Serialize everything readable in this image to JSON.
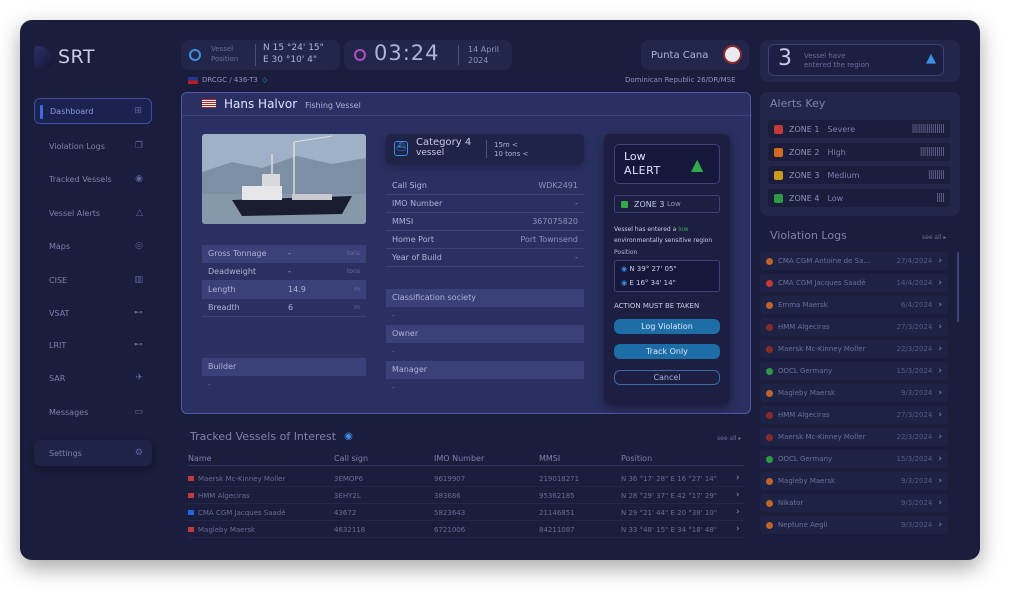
{
  "brand": {
    "name": "SRT"
  },
  "sidebar": {
    "items": [
      {
        "label": "Dashboard",
        "icon": "grid-icon"
      },
      {
        "label": "Violation Logs",
        "icon": "copy-icon"
      },
      {
        "label": "Tracked Vessels",
        "icon": "radar-icon"
      },
      {
        "label": "Vessel Alerts",
        "icon": "warning-icon"
      },
      {
        "label": "Maps",
        "icon": "globe-icon"
      },
      {
        "label": "CISE",
        "icon": "building-icon"
      },
      {
        "label": "VSAT",
        "icon": "satellite-icon"
      },
      {
        "label": "LRIT",
        "icon": "satellite-icon"
      },
      {
        "label": "SAR",
        "icon": "plane-icon"
      },
      {
        "label": "Messages",
        "icon": "chat-icon"
      }
    ],
    "settings": "Settings"
  },
  "topbar": {
    "position_label_1": "Vessel",
    "position_label_2": "Position",
    "lat": "N 15 °24' 15\"",
    "lon": "E 30 °10' 4\"",
    "time": "03:24",
    "date_1": "14 April",
    "date_2": "2024",
    "location": "Punta Cana",
    "vessel_code": "DRCGC / 436-T3",
    "region": "Dominican Republic 26/DR/MSE",
    "vessels_count": "3",
    "vessels_text_1": "Vessel have",
    "vessels_text_2": "entered the region"
  },
  "modal": {
    "vessel_name": "Hans Halvor",
    "vessel_type": "Fishing Vessel",
    "category": "Category 4",
    "category_sub": "vessel",
    "dim1": "15m <",
    "dim2": "10 tons <",
    "info_rows": [
      {
        "label": "Call Sign",
        "value": "WDK2491"
      },
      {
        "label": "IMO Number",
        "value": "-"
      },
      {
        "label": "MMSI",
        "value": "367075820"
      },
      {
        "label": "Home Port",
        "value": "Port Townsend"
      },
      {
        "label": "Year of Build",
        "value": "-"
      }
    ],
    "specs": [
      {
        "label": "Gross Tonnage",
        "value": "-",
        "unit": "tons"
      },
      {
        "label": "Deadweight",
        "value": "-",
        "unit": "tons"
      },
      {
        "label": "Length",
        "value": "14.9",
        "unit": "m"
      },
      {
        "label": "Breadth",
        "value": "6",
        "unit": "m"
      }
    ],
    "builder_label": "Builder",
    "builder_value": "-",
    "classification_label": "Classification society",
    "classification_value": "-",
    "owner_label": "Owner",
    "owner_value": "-",
    "manager_label": "Manager",
    "manager_value": "-"
  },
  "alert_panel": {
    "title_1": "Low",
    "title_2": "ALERT",
    "zone": "ZONE 3",
    "zone_level": "Low",
    "message_1": "Vessel has entered a",
    "message_low": "low",
    "message_2": "environmentally sensitive region",
    "position_label": "Position",
    "lat": "N 39° 27' 05\"",
    "lon": "E 16° 34' 14\"",
    "action": "ACTION MUST BE TAKEN",
    "btn_log": "Log Violation",
    "btn_track": "Track Only",
    "btn_cancel": "Cancel"
  },
  "alerts_key": {
    "title": "Alerts Key",
    "zones": [
      {
        "zone": "ZONE 1",
        "level": "Severe",
        "color": "#c23a3a",
        "bars": "||||||||||||||||"
      },
      {
        "zone": "ZONE 2",
        "level": "High",
        "color": "#d36a22",
        "bars": "||||||||||||"
      },
      {
        "zone": "ZONE 3",
        "level": "Medium",
        "color": "#c99a1c",
        "bars": "||||||||"
      },
      {
        "zone": "ZONE 4",
        "level": "Low",
        "color": "#2f9a43",
        "bars": "||||"
      }
    ]
  },
  "violation_logs": {
    "title": "Violation Logs",
    "see_all": "see all",
    "items": [
      {
        "name": "CMA CGM Antoine de Sa...",
        "date": "27/4/2024",
        "color": "#c0652a"
      },
      {
        "name": "CMA CGM Jacques Saadé",
        "date": "14/4/2024",
        "color": "#c23a3a"
      },
      {
        "name": "Emma Maersk",
        "date": "6/4/2024",
        "color": "#c0652a"
      },
      {
        "name": "HMM Algeciras",
        "date": "27/3/2024",
        "color": "#8a2a2a"
      },
      {
        "name": "Maersk Mc-Kinney Moller",
        "date": "22/3/2024",
        "color": "#8a2a2a"
      },
      {
        "name": "OOCL Germany",
        "date": "15/3/2024",
        "color": "#2f9a43"
      },
      {
        "name": "Magleby Maersk",
        "date": "9/3/2024",
        "color": "#c0652a"
      },
      {
        "name": "HMM Algeciras",
        "date": "27/3/2024",
        "color": "#8a2a2a"
      },
      {
        "name": "Maersk Mc-Kinney Moller",
        "date": "22/3/2024",
        "color": "#8a2a2a"
      },
      {
        "name": "OOCL Germany",
        "date": "15/3/2024",
        "color": "#2f9a43"
      },
      {
        "name": "Magleby Maersk",
        "date": "9/3/2024",
        "color": "#c0652a"
      },
      {
        "name": "Nikator",
        "date": "9/3/2024",
        "color": "#c0652a"
      },
      {
        "name": "Neptune Aegli",
        "date": "9/3/2024",
        "color": "#c0652a"
      }
    ]
  },
  "tracked": {
    "title": "Tracked Vessels of Interest",
    "see_all": "see all",
    "columns": [
      "Name",
      "Call sign",
      "IMO Number",
      "MMSI",
      "Position"
    ],
    "rows": [
      {
        "name": "Maersk Mc-Kinney Moller",
        "call": "3EMOP6",
        "imo": "9619907",
        "mmsi": "219018271",
        "pos": "N 36 °17' 28\" E 16 °27' 14\""
      },
      {
        "name": "HMM Algeciras",
        "call": "3EHY2L",
        "imo": "383686",
        "mmsi": "95362185",
        "pos": "N 28 °29' 37\" E 42 °17' 29\""
      },
      {
        "name": "CMA CGM Jacques Saadé",
        "call": "43672",
        "imo": "5823643",
        "mmsi": "21146851",
        "pos": "N 29 °21' 44\" E 20 °38' 10\""
      },
      {
        "name": "Magleby Maersk",
        "call": "4632118",
        "imo": "6721006",
        "mmsi": "84211087",
        "pos": "N 33 °48' 15\" E 34 °18' 48\""
      }
    ]
  }
}
